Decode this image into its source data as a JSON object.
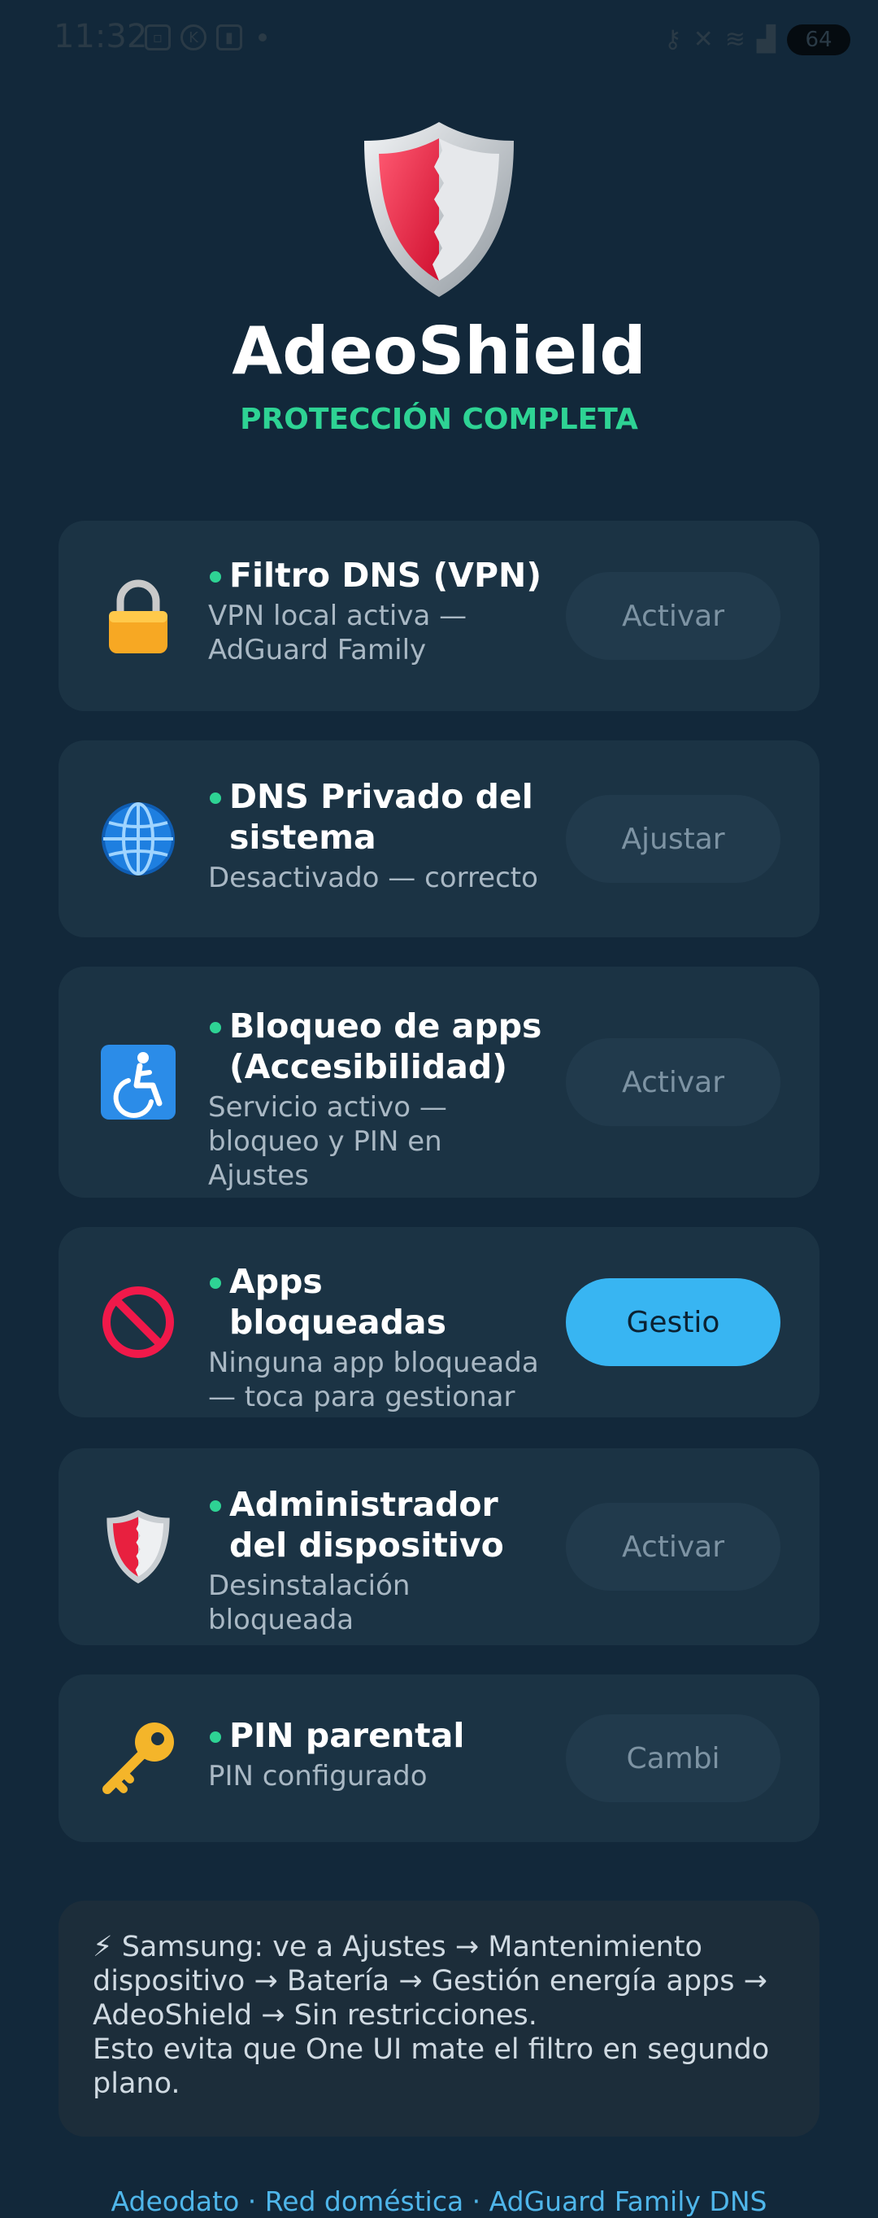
{
  "status_bar": {
    "time": "11:32",
    "battery": "64",
    "left_icons": [
      "screenshot-icon",
      "k-icon",
      "sim-icon"
    ],
    "right_icons": [
      "vpn-key-icon",
      "mute-icon",
      "wifi-icon",
      "signal-icon"
    ]
  },
  "header": {
    "app_name": "AdeoShield",
    "status": "PROTECCIÓN COMPLETA"
  },
  "cards": [
    {
      "icon": "lock-icon",
      "title": "Filtro DNS (VPN)",
      "desc": "VPN local activa — AdGuard Family",
      "button": "Activar",
      "active": false
    },
    {
      "icon": "globe-icon",
      "title": "DNS Privado del sistema",
      "desc": "Desactivado — correcto",
      "button": "Ajustar",
      "active": false
    },
    {
      "icon": "accessibility-icon",
      "title": "Bloqueo de apps (Accesibilidad)",
      "desc": "Servicio activo — bloqueo y PIN en Ajustes",
      "button": "Activar",
      "active": false
    },
    {
      "icon": "prohibited-icon",
      "title": "Apps bloqueadas",
      "desc": "Ninguna app bloqueada — toca para gestionar",
      "button": "Gestio",
      "active": true
    },
    {
      "icon": "shield-icon",
      "title": "Administrador del dispositivo",
      "desc": "Desinstalación bloqueada",
      "button": "Activar",
      "active": false
    },
    {
      "icon": "key-icon",
      "title": "PIN parental",
      "desc": "PIN configurado",
      "button": "Cambi",
      "active": false
    }
  ],
  "note": {
    "icon": "lightning-icon",
    "line1": "⚡ Samsung: ve a Ajustes → Mantenimiento dispositivo → Batería → Gestión energía apps → AdeoShield → Sin restricciones.",
    "line2": "Esto evita que One UI mate el filtro en segundo plano."
  },
  "footer": "Adeodato · Red doméstica · AdGuard Family DNS",
  "colors": {
    "background": "#12283a",
    "card": "#1b3344",
    "accent_green": "#2ed394",
    "accent_blue": "#38b5f2",
    "footer_link": "#4fb6ea"
  }
}
